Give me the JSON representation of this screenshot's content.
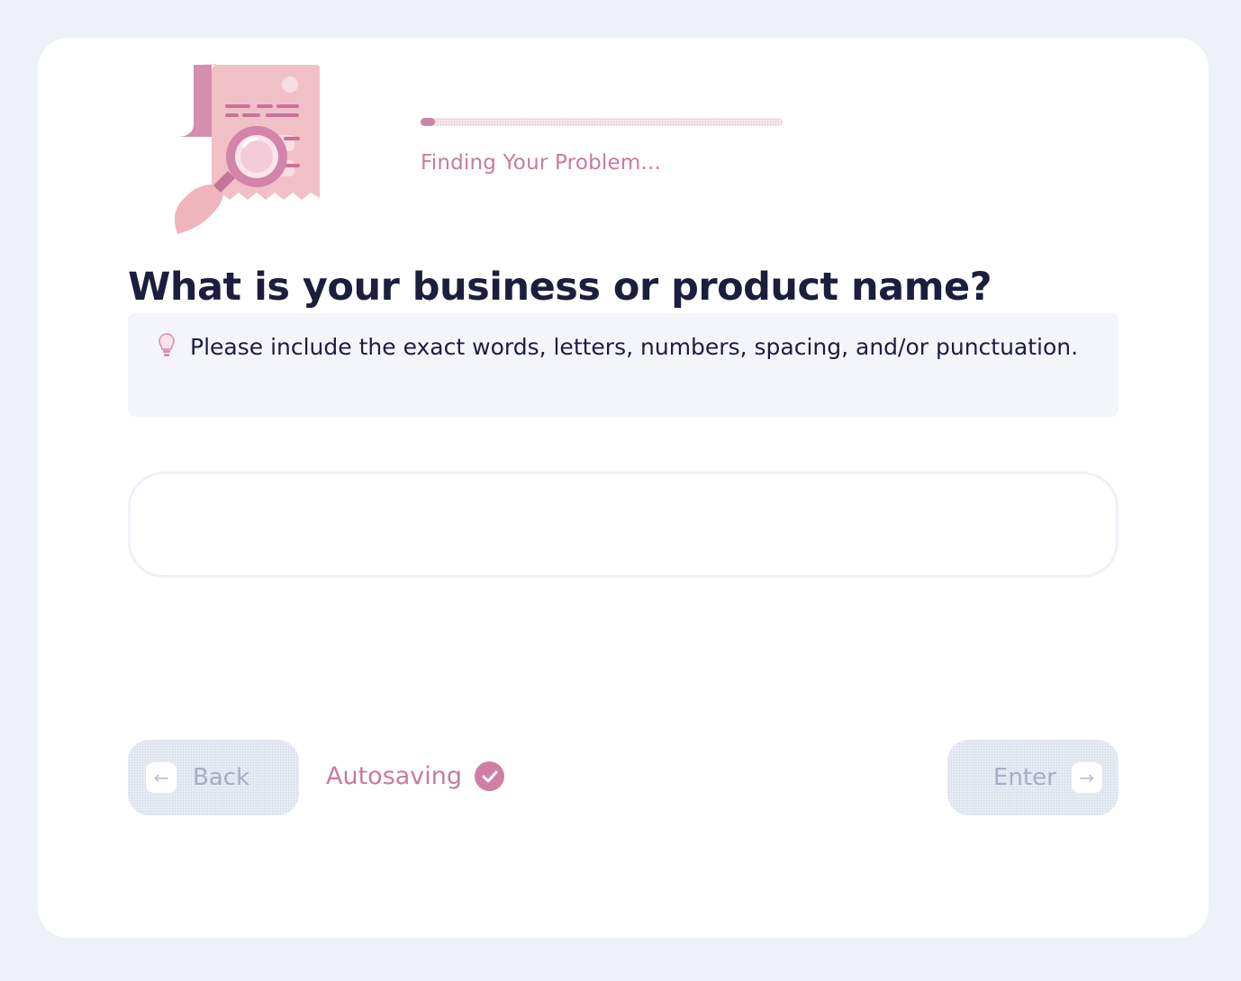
{
  "progress": {
    "percent": 4,
    "status_text": "Finding Your Problem..."
  },
  "question": {
    "title": "What is your business or product name?",
    "hint_icon": "lightbulb-icon",
    "hint": "Please include the exact words, letters, numbers, spacing, and/or punctuation."
  },
  "answer": {
    "value": "",
    "placeholder": ""
  },
  "footer": {
    "back_label": "Back",
    "back_icon": "arrow-left-icon",
    "autosave_label": "Autosaving",
    "autosave_icon": "check-circle-icon",
    "enter_label": "Enter",
    "enter_icon": "arrow-right-icon"
  },
  "colors": {
    "background": "#eef1f7",
    "card": "#ffffff",
    "accent_pink": "#cf83a6",
    "text_dark": "#1b1f3d",
    "muted": "#a6adc6"
  }
}
